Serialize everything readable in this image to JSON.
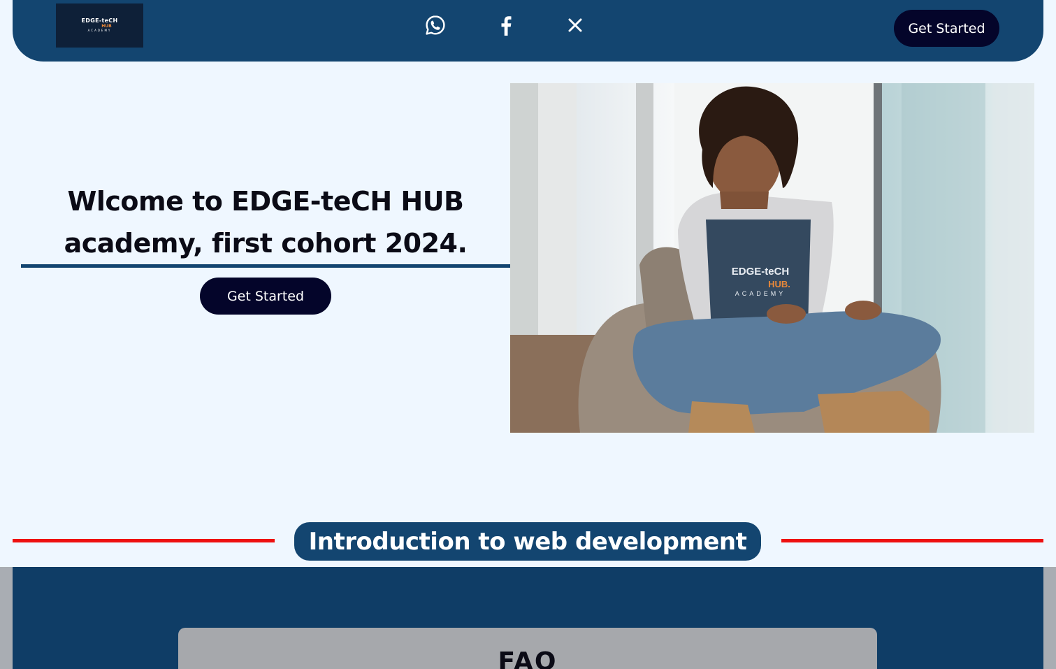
{
  "nav": {
    "logo": {
      "line1": "EDGE-teCH",
      "line2": "HUB",
      "line3": "ACADEMY"
    },
    "social": [
      {
        "icon": "whatsapp-icon"
      },
      {
        "icon": "facebook-icon"
      },
      {
        "icon": "x-icon"
      }
    ],
    "cta_label": "Get Started"
  },
  "hero": {
    "title_line1": "Wlcome to EDGE-teCH HUB",
    "title_line2": "academy, first cohort 2024.",
    "cta_label": "Get Started",
    "shirt_logo": {
      "line1": "EDGE-teCH",
      "line2": "HUB.",
      "line3": "ACADEMY"
    }
  },
  "intro": {
    "title": "Introduction to web development"
  },
  "faq": {
    "title": "FAQ"
  },
  "colors": {
    "navy": "#134570",
    "dark_button": "#04052a",
    "page_bg": "#eff7ff",
    "accent_red": "#ee1010",
    "logo_orange": "#e8883a"
  }
}
